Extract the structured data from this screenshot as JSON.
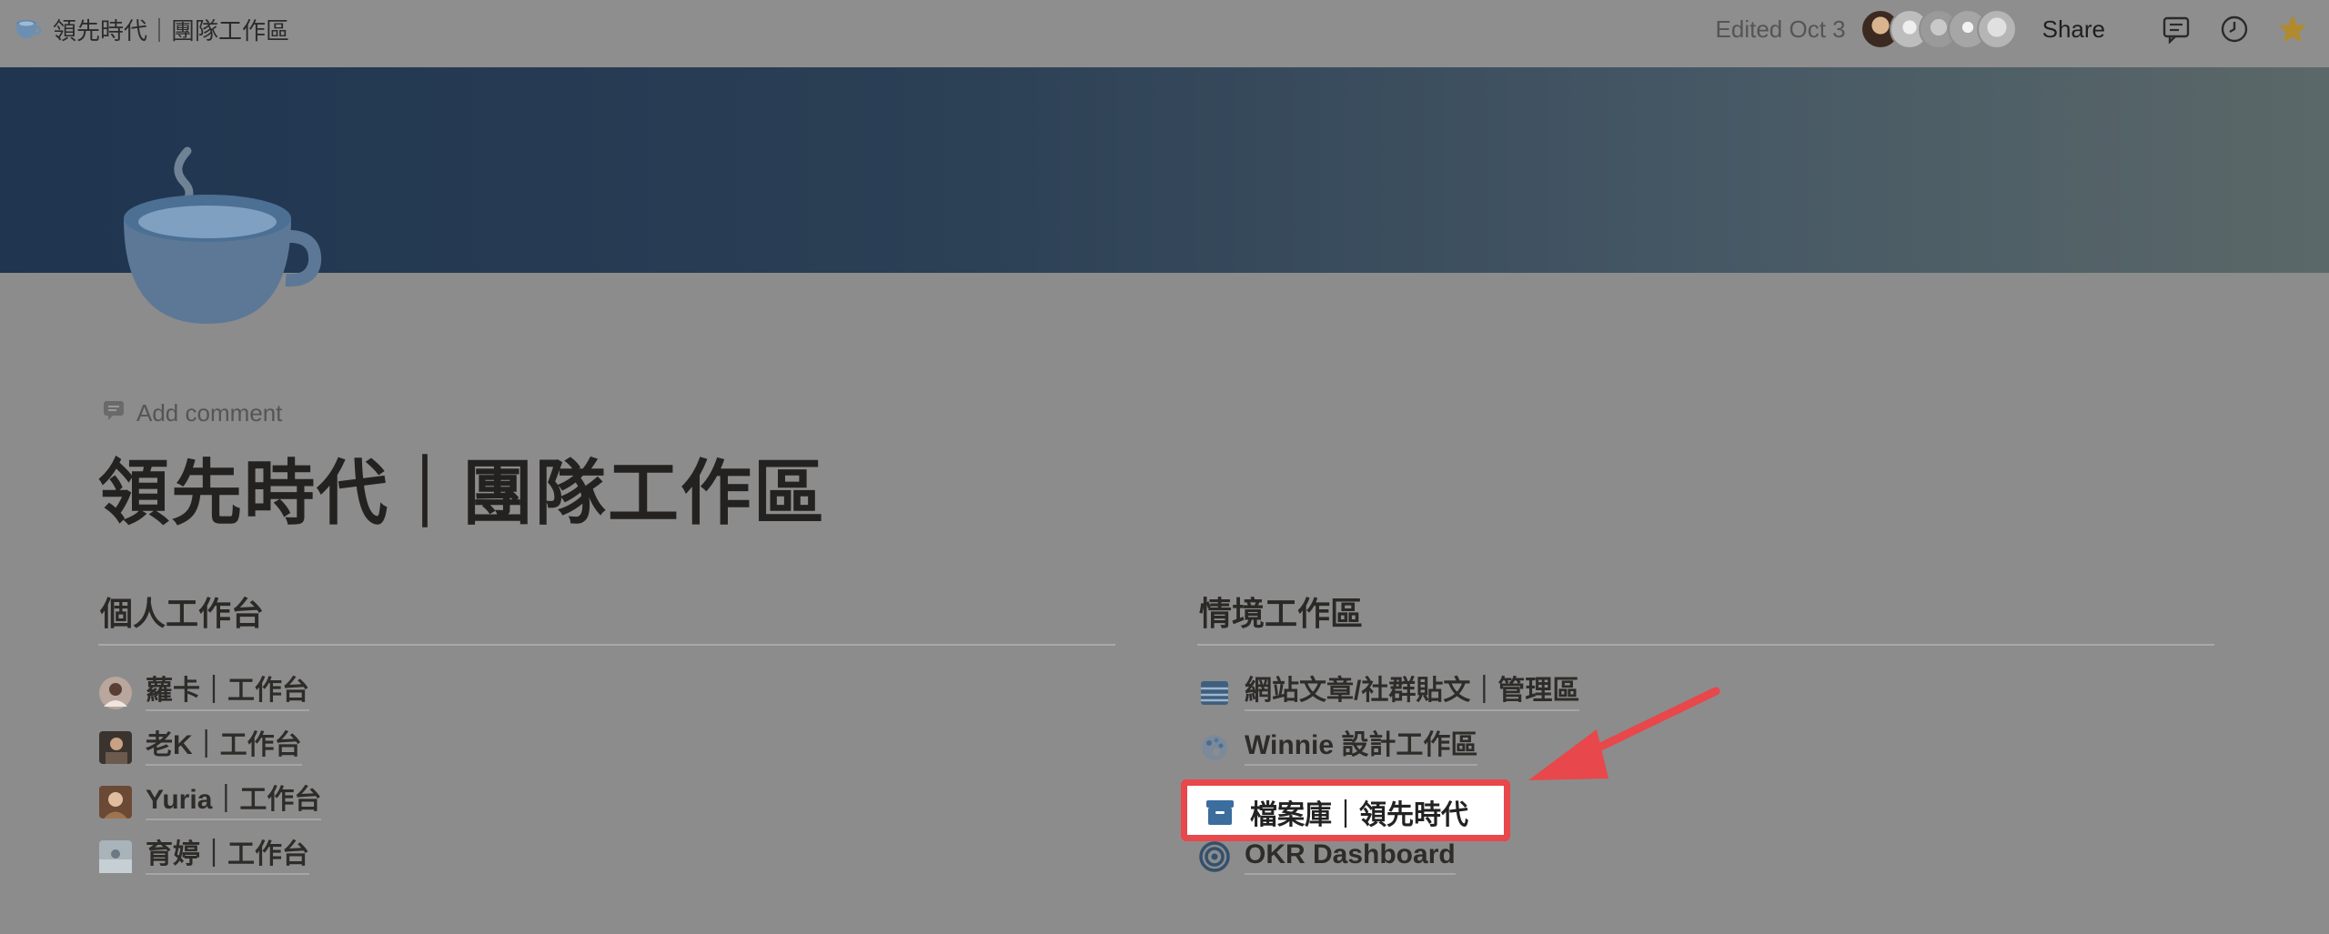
{
  "topbar": {
    "title": "領先時代｜團隊工作區",
    "edited": "Edited Oct 3",
    "share": "Share"
  },
  "page": {
    "add_comment": "Add comment",
    "title": "領先時代｜團隊工作區"
  },
  "left_column": {
    "heading": "個人工作台",
    "items": [
      {
        "label": "蘿卡｜工作台"
      },
      {
        "label": "老K｜工作台"
      },
      {
        "label": "Yuria｜工作台"
      },
      {
        "label": "育婷｜工作台"
      }
    ]
  },
  "right_column": {
    "heading": "情境工作區",
    "items": [
      {
        "label": "網站文章/社群貼文｜管理區",
        "icon": "list-icon"
      },
      {
        "label": "Winnie 設計工作區",
        "icon": "palette-icon"
      },
      {
        "label": "檔案庫｜領先時代",
        "icon": "archive-box-icon"
      },
      {
        "label": "OKR Dashboard",
        "icon": "target-icon"
      }
    ]
  },
  "colors": {
    "highlight_border": "#e8474b",
    "arrow": "#e8474b",
    "cover_start": "#1f3550",
    "cover_end": "#5b6869"
  }
}
